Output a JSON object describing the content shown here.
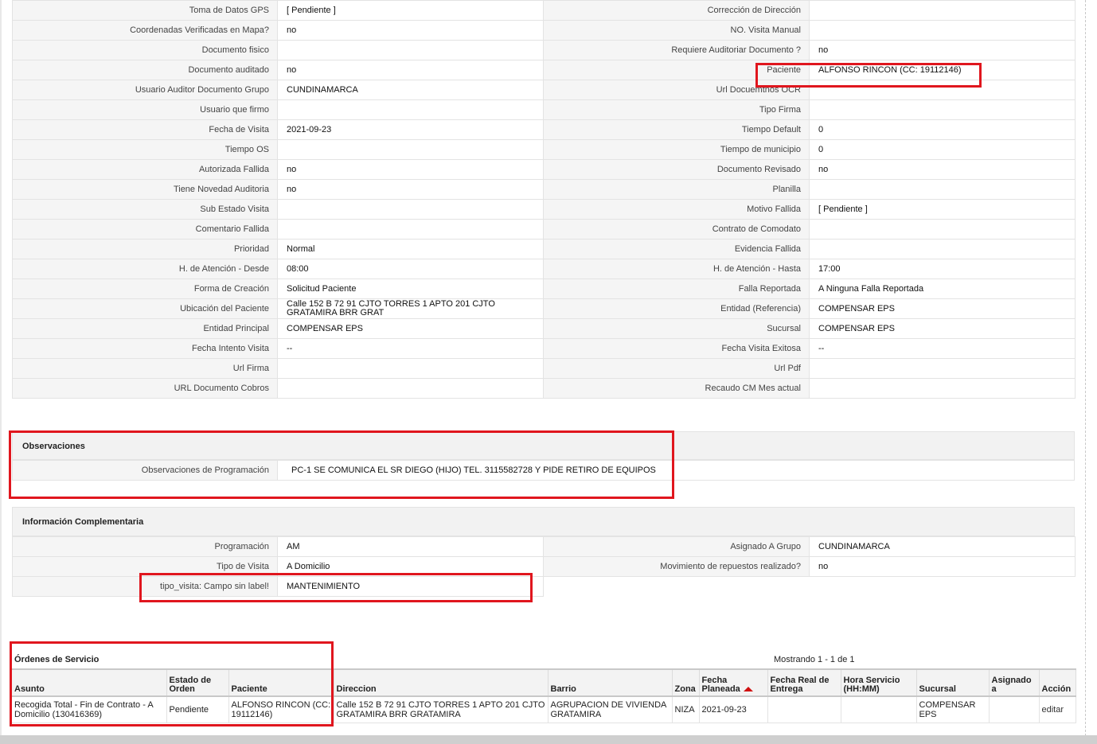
{
  "details": {
    "rows": [
      {
        "l1": "Toma de Datos GPS",
        "v1": "[ Pendiente ]",
        "l2": "Corrección de Dirección",
        "v2": ""
      },
      {
        "l1": "Coordenadas Verificadas en Mapa?",
        "v1": "no",
        "l2": "NO. Visita Manual",
        "v2": ""
      },
      {
        "l1": "Documento fisico",
        "v1": "",
        "l2": "Requiere Auditoriar Documento ?",
        "v2": "no"
      },
      {
        "l1": "Documento auditado",
        "v1": "no",
        "l2": "Paciente",
        "v2": "ALFONSO RINCON (CC: 19112146)"
      },
      {
        "l1": "Usuario Auditor Documento Grupo",
        "v1": "CUNDINAMARCA",
        "l2": "Url Docuemtnos OCR",
        "v2": ""
      },
      {
        "l1": "Usuario que firmo",
        "v1": "",
        "l2": "Tipo Firma",
        "v2": ""
      },
      {
        "l1": "Fecha de Visita",
        "v1": "2021-09-23",
        "l2": "Tiempo Default",
        "v2": "0"
      },
      {
        "l1": "Tiempo OS",
        "v1": "",
        "l2": "Tiempo de municipio",
        "v2": "0"
      },
      {
        "l1": "Autorizada Fallida",
        "v1": "no",
        "l2": "Documento Revisado",
        "v2": "no"
      },
      {
        "l1": "Tiene Novedad Auditoria",
        "v1": "no",
        "l2": "Planilla",
        "v2": ""
      },
      {
        "l1": "Sub Estado Visita",
        "v1": "",
        "l2": "Motivo Fallida",
        "v2": "[ Pendiente ]"
      },
      {
        "l1": "Comentario Fallida",
        "v1": "",
        "l2": "Contrato de Comodato",
        "v2": ""
      },
      {
        "l1": "Prioridad",
        "v1": "Normal",
        "l2": "Evidencia Fallida",
        "v2": ""
      },
      {
        "l1": "H. de Atención - Desde",
        "v1": "08:00",
        "l2": "H. de Atención - Hasta",
        "v2": "17:00"
      },
      {
        "l1": "Forma de Creación",
        "v1": "Solicitud Paciente",
        "l2": "Falla Reportada",
        "v2": "A Ninguna Falla Reportada"
      },
      {
        "l1": "Ubicación del Paciente",
        "v1": "Calle 152 B 72 91 CJTO TORRES 1 APTO 201 CJTO GRATAMIRA BRR GRAT",
        "l2": "Entidad (Referencia)",
        "v2": "COMPENSAR EPS"
      },
      {
        "l1": "Entidad Principal",
        "v1": "COMPENSAR EPS",
        "l2": "Sucursal",
        "v2": "COMPENSAR EPS"
      },
      {
        "l1": "Fecha Intento Visita",
        "v1": "--",
        "l2": "Fecha Visita Exitosa",
        "v2": "--"
      },
      {
        "l1": "Url Firma",
        "v1": "",
        "l2": "Url Pdf",
        "v2": ""
      },
      {
        "l1": "URL Documento Cobros",
        "v1": "",
        "l2": "Recaudo CM Mes actual",
        "v2": ""
      }
    ]
  },
  "observaciones": {
    "title": "Observaciones",
    "label": "Observaciones de Programación",
    "value": "PC-1 SE COMUNICA EL SR DIEGO (HIJO) TEL. 3115582728 Y PIDE RETIRO DE EQUIPOS"
  },
  "complementaria": {
    "title": "Información Complementaria",
    "programacion_label": "Programación",
    "programacion_value": "AM",
    "grupo_label": "Asignado A Grupo",
    "grupo_value": "CUNDINAMARCA",
    "tipo_label": "Tipo de Visita",
    "tipo_value": "A Domicilio",
    "repuestos_label": "Movimiento de repuestos realizado?",
    "repuestos_value": "no",
    "tipo_visita_label": "tipo_visita: Campo sin label!",
    "tipo_visita_value": "MANTENIMIENTO"
  },
  "ordenes": {
    "title": "Órdenes de Servicio",
    "count": "Mostrando 1 - 1 de 1",
    "headers": {
      "asunto": "Asunto",
      "estado": "Estado de Orden",
      "paciente": "Paciente",
      "direccion": "Direccion",
      "barrio": "Barrio",
      "zona": "Zona",
      "fecha_planeada": "Fecha Planeada",
      "fecha_real": "Fecha Real de Entrega",
      "hora": "Hora Servicio (HH:MM)",
      "sucursal": "Sucursal",
      "asignado": "Asignado a",
      "accion": "Acción"
    },
    "row": {
      "asunto": "Recogida Total - Fin de Contrato - A Domicilio (130416369)",
      "estado": "Pendiente",
      "paciente": "ALFONSO RINCON (CC: 19112146)",
      "direccion": "Calle 152 B 72 91 CJTO TORRES 1 APTO 201 CJTO GRATAMIRA BRR GRATAMIRA",
      "barrio": "AGRUPACION DE VIVIENDA GRATAMIRA",
      "zona": "NIZA",
      "fecha_planeada": "2021-09-23",
      "fecha_real": "",
      "hora": "",
      "sucursal": "COMPENSAR EPS",
      "asignado": "",
      "accion": "editar"
    }
  },
  "colors": {
    "highlight": "#e0161e",
    "label_bg": "#f5f5f5",
    "border": "#e3e3e3"
  }
}
